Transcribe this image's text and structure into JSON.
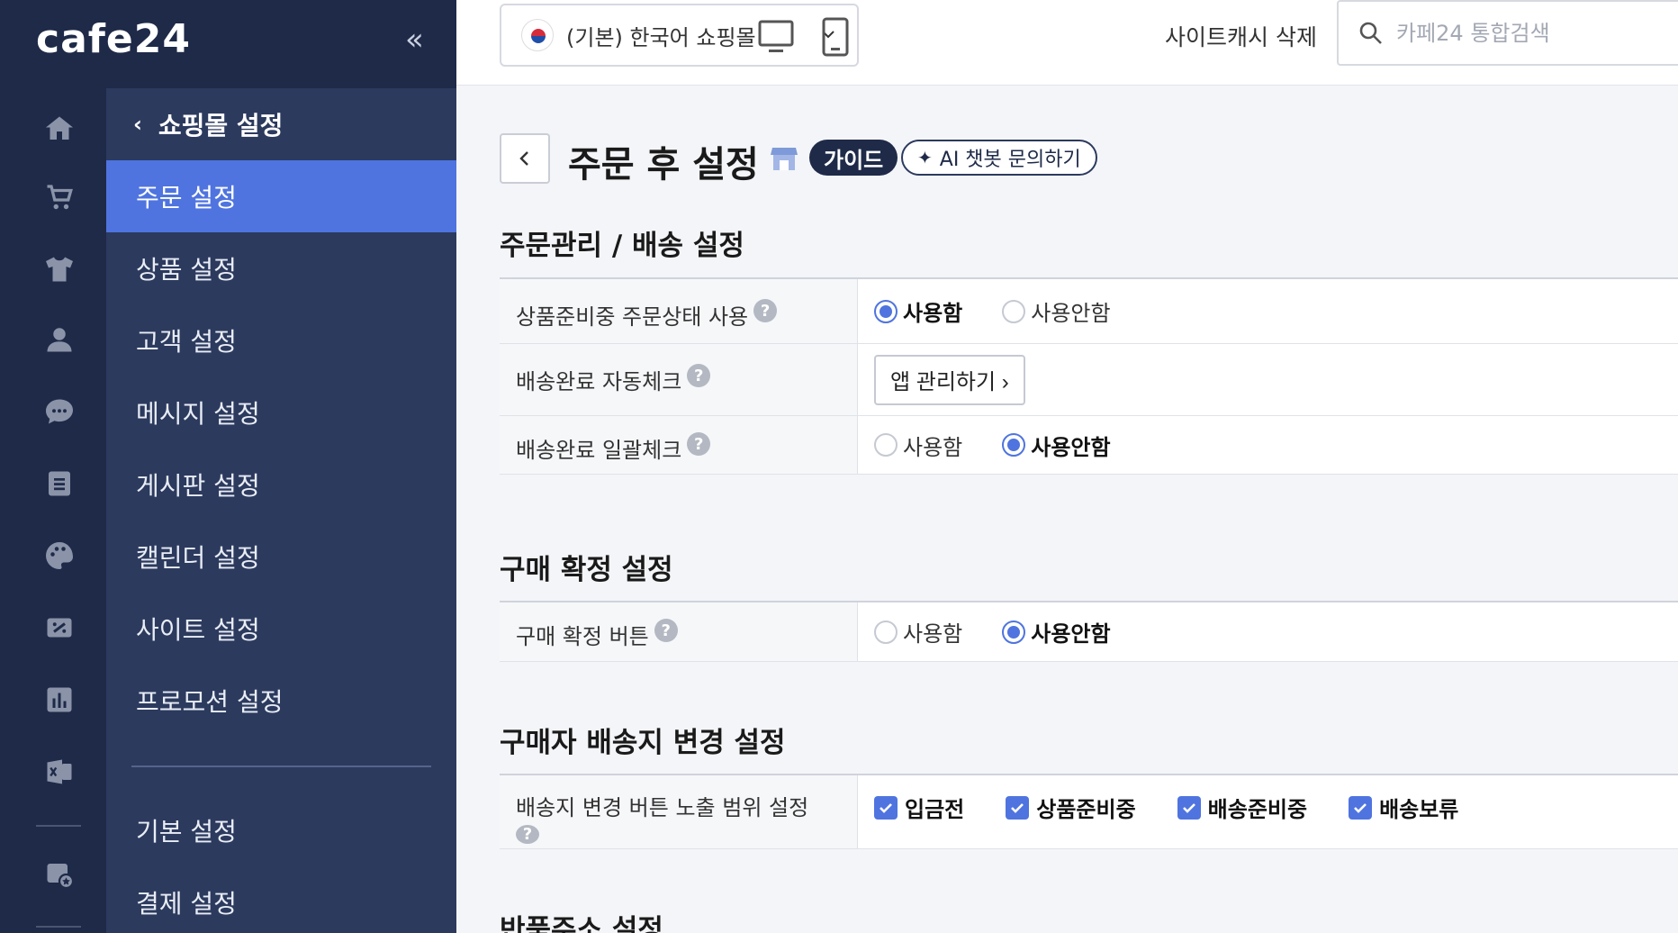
{
  "brand": {
    "logo": "cafe24",
    "collapse": "«"
  },
  "rail": {
    "icons": [
      "home-icon",
      "cart-icon",
      "shirt-icon",
      "user-icon",
      "chat-icon",
      "board-icon",
      "palette-icon",
      "promotion-icon",
      "chart-icon",
      "excel-icon",
      "settings-star-icon"
    ]
  },
  "sidebar": {
    "back_label": "쇼핑몰 설정",
    "items": [
      {
        "label": "주문 설정",
        "active": true
      },
      {
        "label": "상품 설정"
      },
      {
        "label": "고객 설정"
      },
      {
        "label": "메시지 설정"
      },
      {
        "label": "게시판 설정"
      },
      {
        "label": "캘린더 설정"
      },
      {
        "label": "사이트 설정"
      },
      {
        "label": "프로모션 설정"
      }
    ],
    "bottom_items": [
      {
        "label": "기본 설정"
      },
      {
        "label": "결제 설정"
      }
    ]
  },
  "topbar": {
    "shop_select": "(기본) 한국어 쇼핑몰",
    "cache_button": "사이트캐시 삭제",
    "search_placeholder": "카페24 통합검색"
  },
  "page": {
    "title": "주문 후 설정",
    "guide": "가이드",
    "ai_chat": "AI 챗봇 문의하기"
  },
  "sections": {
    "order": {
      "title": "주문관리 / 배송 설정",
      "row1_label": "상품준비중 주문상태 사용",
      "row1_opt_on": "사용함",
      "row1_opt_off": "사용안함",
      "row2_label": "배송완료 자동체크",
      "row2_button": "앱 관리하기 ›",
      "row3_label": "배송완료 일괄체크",
      "row3_opt_on": "사용함",
      "row3_opt_off": "사용안함"
    },
    "confirm": {
      "title": "구매 확정 설정",
      "row1_label": "구매 확정 버튼",
      "row1_opt_on": "사용함",
      "row1_opt_off": "사용안함"
    },
    "address": {
      "title": "구매자 배송지 변경 설정",
      "row1_label": "배송지 변경 버튼 노출 범위 설정",
      "checks": [
        "입금전",
        "상품준비중",
        "배송준비중",
        "배송보류"
      ]
    },
    "return": {
      "title": "반품주소 설정"
    }
  }
}
